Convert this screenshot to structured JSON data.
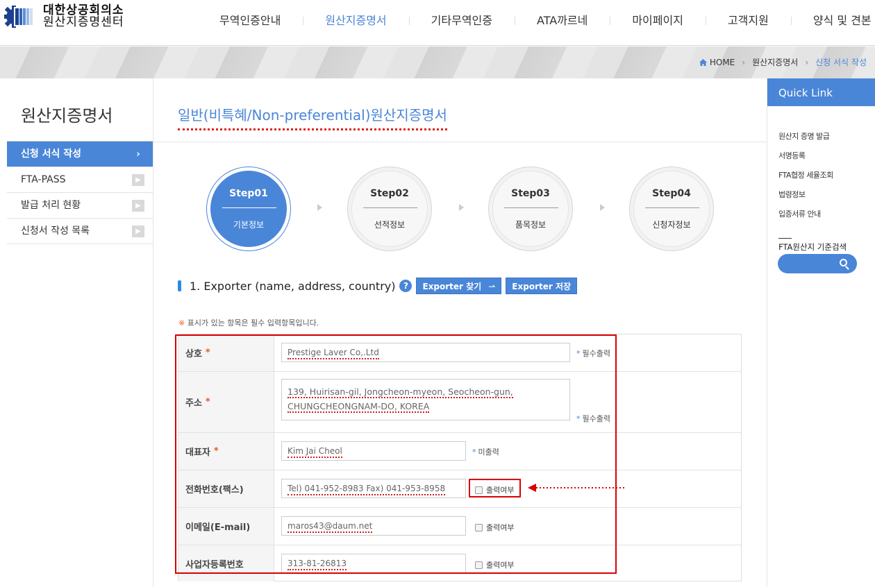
{
  "header": {
    "logo_line1": "대한상공회의소",
    "logo_line2": "원산지증명센터",
    "nav": [
      "무역인증안내",
      "원산지증명서",
      "기타무역인증",
      "ATA까르네",
      "마이페이지",
      "고객지원",
      "양식 및 견본"
    ],
    "nav_active_index": 1
  },
  "breadcrumb": {
    "home": "HOME",
    "level1": "원산지증명서",
    "current": "신청 서식 작성"
  },
  "sidebar": {
    "title": "원산지증명서",
    "items": [
      {
        "label": "신청 서식 작성",
        "active": true
      },
      {
        "label": "FTA-PASS",
        "active": false
      },
      {
        "label": "발급 처리 현황",
        "active": false
      },
      {
        "label": "신청서 작성 목록",
        "active": false
      }
    ]
  },
  "main": {
    "title": "일반(비특혜/Non-preferential)원산지증명서",
    "steps": [
      {
        "num": "Step01",
        "name": "기본정보",
        "active": true
      },
      {
        "num": "Step02",
        "name": "선적정보",
        "active": false
      },
      {
        "num": "Step03",
        "name": "품목정보",
        "active": false
      },
      {
        "num": "Step04",
        "name": "신청자정보",
        "active": false
      }
    ],
    "section_title": "1. Exporter (name, address, country)",
    "help_glyph": "?",
    "find_button": "Exporter 찾기",
    "save_button": "Exporter 저장",
    "required_note_mark": "※",
    "required_note": "표시가 있는 항목은 필수 입력항목입니다."
  },
  "form": {
    "company_label": "상호",
    "company_value": "Prestige Laver Co,.Ltd",
    "company_note": "필수출력",
    "address_label": "주소",
    "address_value": "139, Huirisan-gil, Jongcheon-myeon, Seocheon-gun, CHUNGCHEONGNAM-DO, KOREA",
    "address_note": "필수출력",
    "ceo_label": "대표자",
    "ceo_value": "Kim Jai Cheol",
    "ceo_note": "미출력",
    "phone_label": "전화번호(팩스)",
    "phone_value": "Tel) 041-952-8983 Fax) 041-953-8958",
    "phone_check": "출력여부",
    "email_label": "이메일(E-mail)",
    "email_value": "maros43@daum.net",
    "email_check": "출력여부",
    "bizno_label": "사업자등록번호",
    "bizno_value": "313-81-26813",
    "bizno_check": "출력여부",
    "required_star": "*"
  },
  "quick_link": {
    "title": "Quick Link",
    "items": [
      "원산지 증명 발급",
      "서명등록",
      "FTA협정 세율조회",
      "법령정보",
      "입증서류 안내"
    ],
    "search_label": "FTA원산지 기준검색"
  },
  "colors": {
    "accent": "#4a86d8",
    "annotation_red": "#d90000"
  }
}
